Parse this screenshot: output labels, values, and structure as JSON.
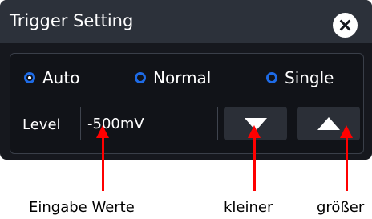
{
  "dialog": {
    "title": "Trigger Setting",
    "close_icon": "close-icon"
  },
  "modes": [
    {
      "label": "Auto",
      "selected": true
    },
    {
      "label": "Normal",
      "selected": false
    },
    {
      "label": "Single",
      "selected": false
    }
  ],
  "level": {
    "label": "Level",
    "value": "-500mV"
  },
  "buttons": {
    "decrease_icon": "triangle-down-icon",
    "increase_icon": "triangle-up-icon"
  },
  "annotations": {
    "input": "Eingabe Werte",
    "decrease": "kleiner",
    "increase": "größer"
  },
  "colors": {
    "radio_accent": "#1e6be6",
    "annotation_arrow": "#ff0000"
  }
}
